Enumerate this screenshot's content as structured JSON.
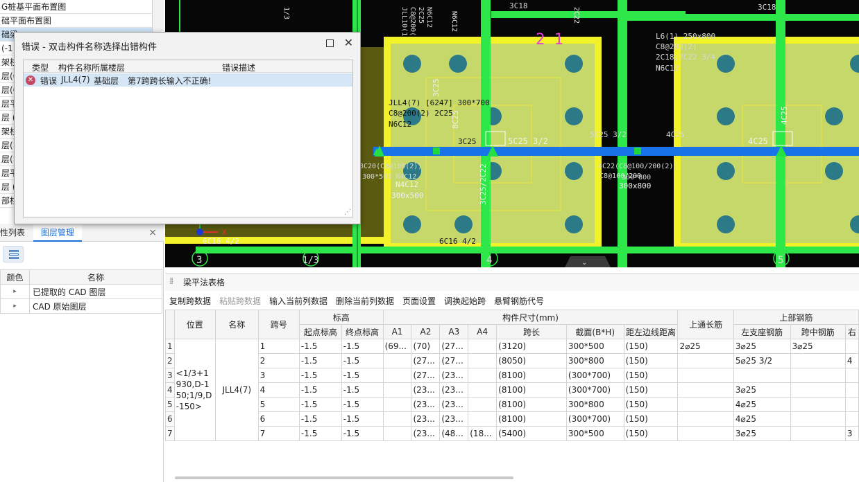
{
  "drawing_list": {
    "items": [
      "G桩基平面布置图",
      "础平面布置图",
      "础梁",
      "(-1",
      "架柱",
      "层(6",
      "层(6",
      "层平",
      "层 (6",
      "架柱",
      "层(1",
      "层(1",
      "层平",
      "层 (1",
      "部柱"
    ]
  },
  "panel_tabs": {
    "props": "性列表",
    "layers": "图层管理",
    "close": "×"
  },
  "layer_table": {
    "headers": [
      "颜色",
      "名称"
    ],
    "rows": [
      {
        "expander": "▸",
        "name": "已提取的 CAD 图层"
      },
      {
        "expander": "▸",
        "name": "CAD 原始图层"
      }
    ]
  },
  "cad": {
    "labels": [
      "3C18",
      "3C18",
      "JLL10(1",
      "C8@200(",
      "2C25",
      "N6C12",
      "L6(1) 250x800",
      "C8@200(2)",
      "2C18;7C22 3/4",
      "N6C12",
      "2 1",
      "JLL4(7) [6247] 300*700",
      "C8@200(2) 2C25",
      "N6C12",
      "3C25",
      "8C25",
      "3C25",
      "5C25 3/2",
      "5C25 3/2",
      "4C25",
      "4C25",
      "4C25",
      "3C20(C8@100(2))",
      "300*500 N4C12",
      "N4C12",
      "300x500",
      "4C22(C8@100/200(2))",
      "C8@100/200",
      "300*800",
      "300x800",
      "3C25/2C22",
      "6C16 4/2",
      "6C16 4/2",
      "Y",
      "X",
      "2C22",
      "1/3",
      "N6C12"
    ],
    "axis_labels": [
      "3",
      "1/3",
      "4",
      "5"
    ],
    "colors": {
      "background": "#070707",
      "column": "#2ee84a",
      "pile_cap": "#c6d86a",
      "cap_border": "#f2f22a",
      "beam_selected": "#1873e8",
      "pile": "#2c7a88",
      "text": "#d8d8d8",
      "magenta": "#e040d0"
    }
  },
  "dialog": {
    "title": "错误 - 双击构件名称选择出错构件",
    "headers": {
      "type": "类型",
      "name_floor": "构件名称所属楼层",
      "desc": "错误描述"
    },
    "row": {
      "type": "错误",
      "name": "JLL4(7)",
      "floor": "基础层",
      "desc": "第7跨跨长输入不正确!"
    }
  },
  "grid": {
    "title": "梁平法表格",
    "toolbar": [
      "复制跨数据",
      "粘贴跨数据",
      "输入当前列数据",
      "删除当前列数据",
      "页面设置",
      "调换起始跨",
      "悬臂钢筋代号"
    ],
    "headers": {
      "position": "位置",
      "name": "名称",
      "span": "跨号",
      "elevation": "标高",
      "start_elev": "起点标高",
      "end_elev": "终点标高",
      "dims": "构件尺寸(mm)",
      "a1": "A1",
      "a2": "A2",
      "a3": "A3",
      "a4": "A4",
      "span_len": "跨长",
      "section": "截面(B*H)",
      "dist_left": "距左边线距离",
      "top_through": "上通长筋",
      "top_rebar": "上部钢筋",
      "left_support": "左支座钢筋",
      "mid_span": "跨中钢筋",
      "right_trunc": "右"
    },
    "position_value": "<1/3+1930,D-150;1/9,D-150>",
    "name_value": "JLL4(7)",
    "rows": [
      {
        "n": "1",
        "span": "1",
        "s": "-1.5",
        "e": "-1.5",
        "a1": "(69...",
        "a2": "(70)",
        "a3": "(27...",
        "a4": "",
        "len": "(3120)",
        "sec": "300*500",
        "dist": "(150)",
        "through": "2⌀25",
        "left": "3⌀25",
        "mid": "3⌀25",
        "right": ""
      },
      {
        "n": "2",
        "span": "2",
        "s": "-1.5",
        "e": "-1.5",
        "a1": "",
        "a2": "(27...",
        "a3": "(27...",
        "a4": "",
        "len": "(8050)",
        "sec": "300*800",
        "dist": "(150)",
        "through": "",
        "left": "5⌀25 3/2",
        "mid": "",
        "right": "4"
      },
      {
        "n": "3",
        "span": "3",
        "s": "-1.5",
        "e": "-1.5",
        "a1": "",
        "a2": "(27...",
        "a3": "(23...",
        "a4": "",
        "len": "(8100)",
        "sec": "(300*700)",
        "dist": "(150)",
        "through": "",
        "left": "",
        "mid": "",
        "right": ""
      },
      {
        "n": "4",
        "span": "4",
        "s": "-1.5",
        "e": "-1.5",
        "a1": "",
        "a2": "(23...",
        "a3": "(23...",
        "a4": "",
        "len": "(8100)",
        "sec": "(300*700)",
        "dist": "(150)",
        "through": "",
        "left": "3⌀25",
        "mid": "",
        "right": ""
      },
      {
        "n": "5",
        "span": "5",
        "s": "-1.5",
        "e": "-1.5",
        "a1": "",
        "a2": "(23...",
        "a3": "(23...",
        "a4": "",
        "len": "(8100)",
        "sec": "300*800",
        "dist": "(150)",
        "through": "",
        "left": "4⌀25",
        "mid": "",
        "right": ""
      },
      {
        "n": "6",
        "span": "6",
        "s": "-1.5",
        "e": "-1.5",
        "a1": "",
        "a2": "(23...",
        "a3": "(23...",
        "a4": "",
        "len": "(8100)",
        "sec": "(300*700)",
        "dist": "(150)",
        "through": "",
        "left": "4⌀25",
        "mid": "",
        "right": ""
      },
      {
        "n": "7",
        "span": "7",
        "s": "-1.5",
        "e": "-1.5",
        "a1": "",
        "a2": "(23...",
        "a3": "(48...",
        "a4": "(18...",
        "len": "(5400)",
        "sec": "300*500",
        "dist": "(150)",
        "through": "",
        "left": "3⌀25",
        "mid": "",
        "right": "3"
      }
    ]
  }
}
